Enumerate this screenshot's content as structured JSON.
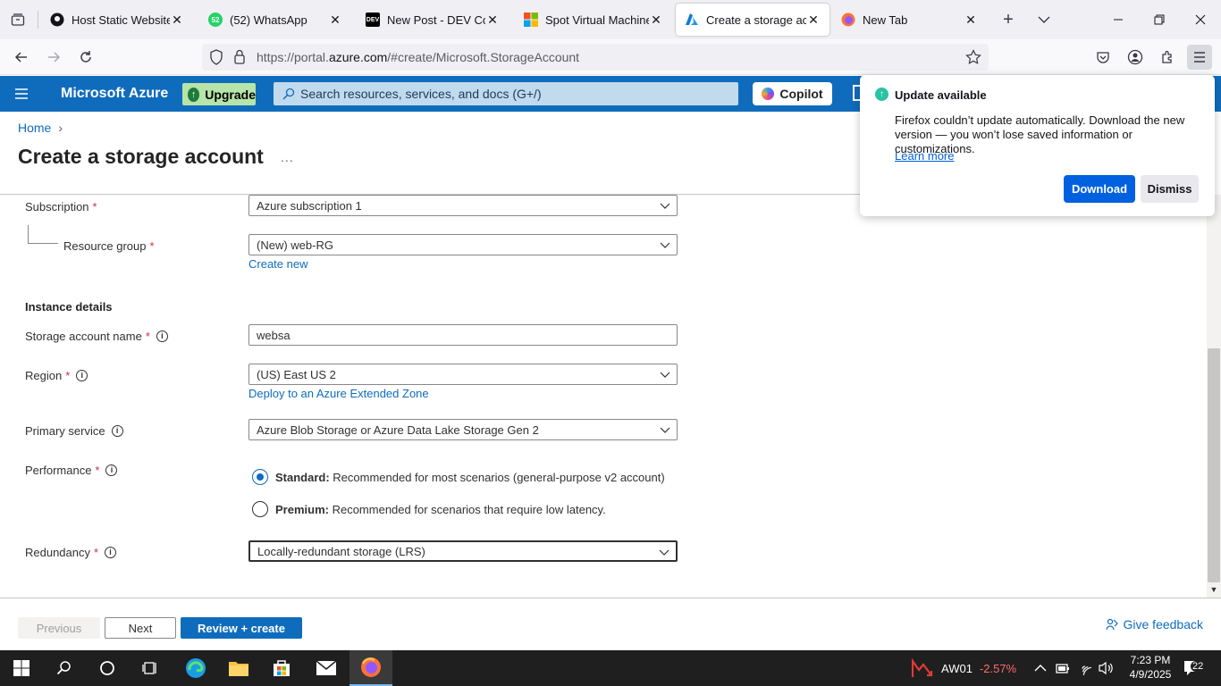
{
  "browser": {
    "tabs": [
      {
        "title": "Host Static Website Az",
        "icon": "github-icon"
      },
      {
        "title": "(52) WhatsApp",
        "icon": "whatsapp-icon",
        "badge": "52"
      },
      {
        "title": "New Post - DEV Comm",
        "icon": "dev-icon",
        "badge": "DEV"
      },
      {
        "title": "Spot Virtual Machines",
        "icon": "microsoft-icon"
      },
      {
        "title": "Create a storage accou",
        "icon": "azure-icon"
      },
      {
        "title": "New Tab",
        "icon": "firefox-icon"
      }
    ],
    "url_prefix": "https://portal.",
    "url_domain": "azure.com",
    "url_suffix": "/#create/Microsoft.StorageAccount"
  },
  "azure_header": {
    "brand": "Microsoft Azure",
    "upgrade": "Upgrade",
    "search_placeholder": "Search resources, services, and docs (G+/)",
    "copilot": "Copilot"
  },
  "page": {
    "breadcrumb": "Home",
    "title": "Create a storage account",
    "more": "..."
  },
  "form": {
    "subscription": {
      "label": "Subscription",
      "required": "*",
      "value": "Azure subscription 1"
    },
    "resource_group": {
      "label": "Resource group",
      "required": "*",
      "value": "(New) web-RG",
      "link": "Create new"
    },
    "instance_heading": "Instance details",
    "storage_name": {
      "label": "Storage account name",
      "required": "*",
      "value": "websa"
    },
    "region": {
      "label": "Region",
      "required": "*",
      "value": "(US) East US 2",
      "link": "Deploy to an Azure Extended Zone"
    },
    "primary_service": {
      "label": "Primary service",
      "value": "Azure Blob Storage or Azure Data Lake Storage Gen 2"
    },
    "performance": {
      "label": "Performance",
      "required": "*",
      "options": [
        {
          "title": "Standard:",
          "desc": " Recommended for most scenarios (general-purpose v2 account)",
          "selected": true
        },
        {
          "title": "Premium:",
          "desc": " Recommended for scenarios that require low latency.",
          "selected": false
        }
      ]
    },
    "redundancy": {
      "label": "Redundancy",
      "required": "*",
      "value": "Locally-redundant storage (LRS)"
    }
  },
  "footer": {
    "previous": "Previous",
    "next": "Next",
    "review": "Review + create",
    "feedback": "Give feedback"
  },
  "update_popup": {
    "title": "Update available",
    "message": "Firefox couldn’t update automatically. Download the new version — you won’t lose saved information or customizations.",
    "learn_more": "Learn more",
    "download": "Download",
    "dismiss": "Dismiss"
  },
  "taskbar": {
    "stock_symbol": "AW01",
    "stock_change": "-2.57%",
    "time": "7:23 PM",
    "date": "4/9/2025",
    "notifications": "22"
  },
  "colors": {
    "azure_blue": "#0f6cbd",
    "required_red": "#c4314b",
    "firefox_blue": "#0061e0",
    "stock_red": "#ff6b6b"
  }
}
